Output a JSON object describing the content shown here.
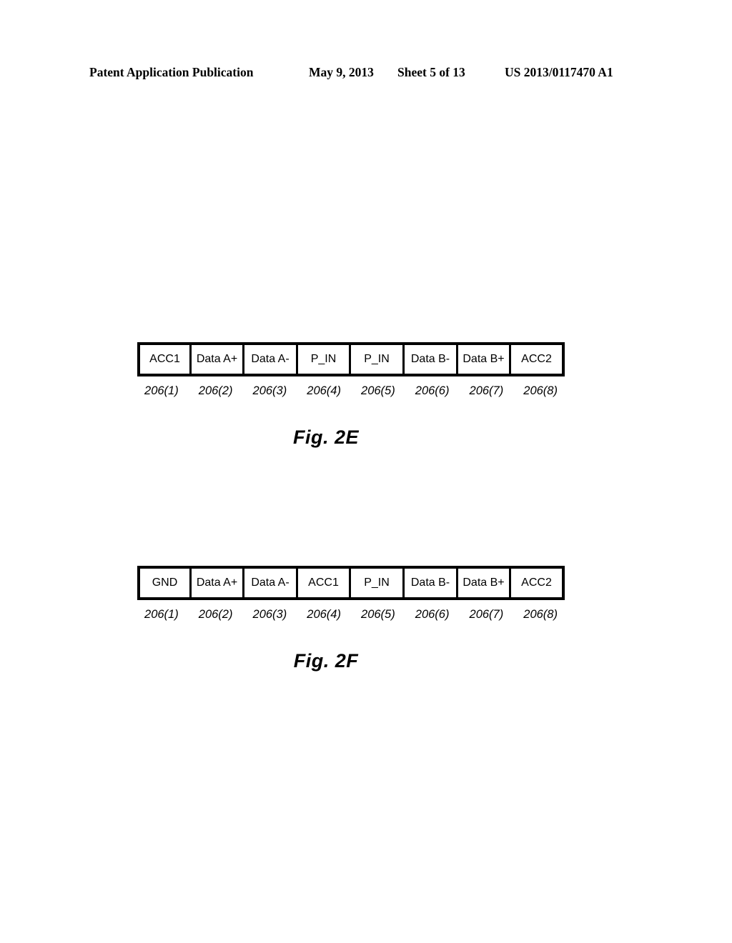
{
  "header": {
    "publication": "Patent Application Publication",
    "date": "May 9, 2013",
    "sheet": "Sheet 5 of 13",
    "patent_number": "US 2013/0117470 A1"
  },
  "figures": [
    {
      "id": "2E",
      "caption": "Fig. 2E",
      "cells": [
        "ACC1",
        "Data A+",
        "Data A-",
        "P_IN",
        "P_IN",
        "Data B-",
        "Data B+",
        "ACC2"
      ],
      "refs": [
        "206(1)",
        "206(2)",
        "206(3)",
        "206(4)",
        "206(5)",
        "206(6)",
        "206(7)",
        "206(8)"
      ]
    },
    {
      "id": "2F",
      "caption": "Fig. 2F",
      "cells": [
        "GND",
        "Data A+",
        "Data A-",
        "ACC1",
        "P_IN",
        "Data B-",
        "Data B+",
        "ACC2"
      ],
      "refs": [
        "206(1)",
        "206(2)",
        "206(3)",
        "206(4)",
        "206(5)",
        "206(6)",
        "206(7)",
        "206(8)"
      ]
    }
  ],
  "colors": {
    "ink": "#000000",
    "paper": "#ffffff"
  }
}
